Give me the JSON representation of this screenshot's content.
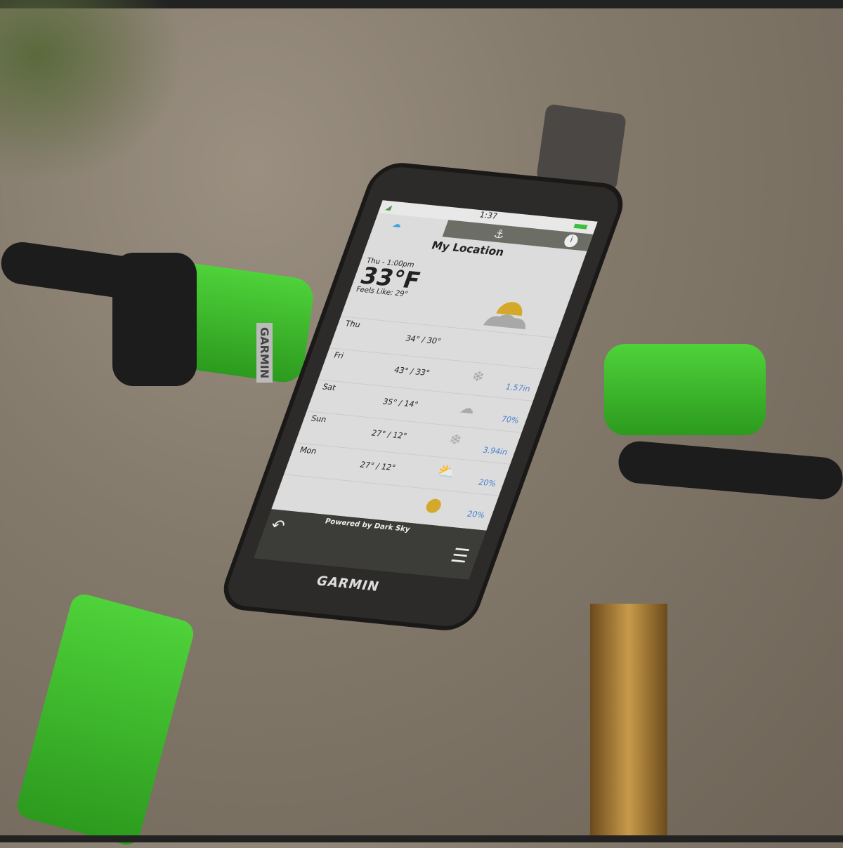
{
  "device": {
    "brand": "GARMIN",
    "side_brand": "GARMIN"
  },
  "screen": {
    "time": "1:37",
    "title": "My Location",
    "current": {
      "date": "Thu - 1:00pm",
      "temp": "33°F",
      "feels_like": "Feels Like: 29°"
    },
    "forecast": [
      {
        "day": "Thu",
        "temps": "34° / 30°",
        "icon": "partly-cloudy-icon",
        "precip": ""
      },
      {
        "day": "Fri",
        "temps": "43° / 33°",
        "icon": "snow-icon",
        "precip": "1.57in"
      },
      {
        "day": "Sat",
        "temps": "35° / 14°",
        "icon": "rain-cloud-icon",
        "precip": "70%"
      },
      {
        "day": "Sun",
        "temps": "27° / 12°",
        "icon": "snow-icon",
        "precip": "3.94in"
      },
      {
        "day": "Mon",
        "temps": "27° / 12°",
        "icon": "partly-sunny-icon",
        "precip": "20%"
      },
      {
        "day": "",
        "temps": "",
        "icon": "sun-icon",
        "precip": "20%"
      }
    ],
    "footer": "Powered by Dark Sky"
  },
  "colors": {
    "sun": "#d4a82a",
    "precip": "#4a7fd0",
    "bike": "#3cc42a"
  }
}
